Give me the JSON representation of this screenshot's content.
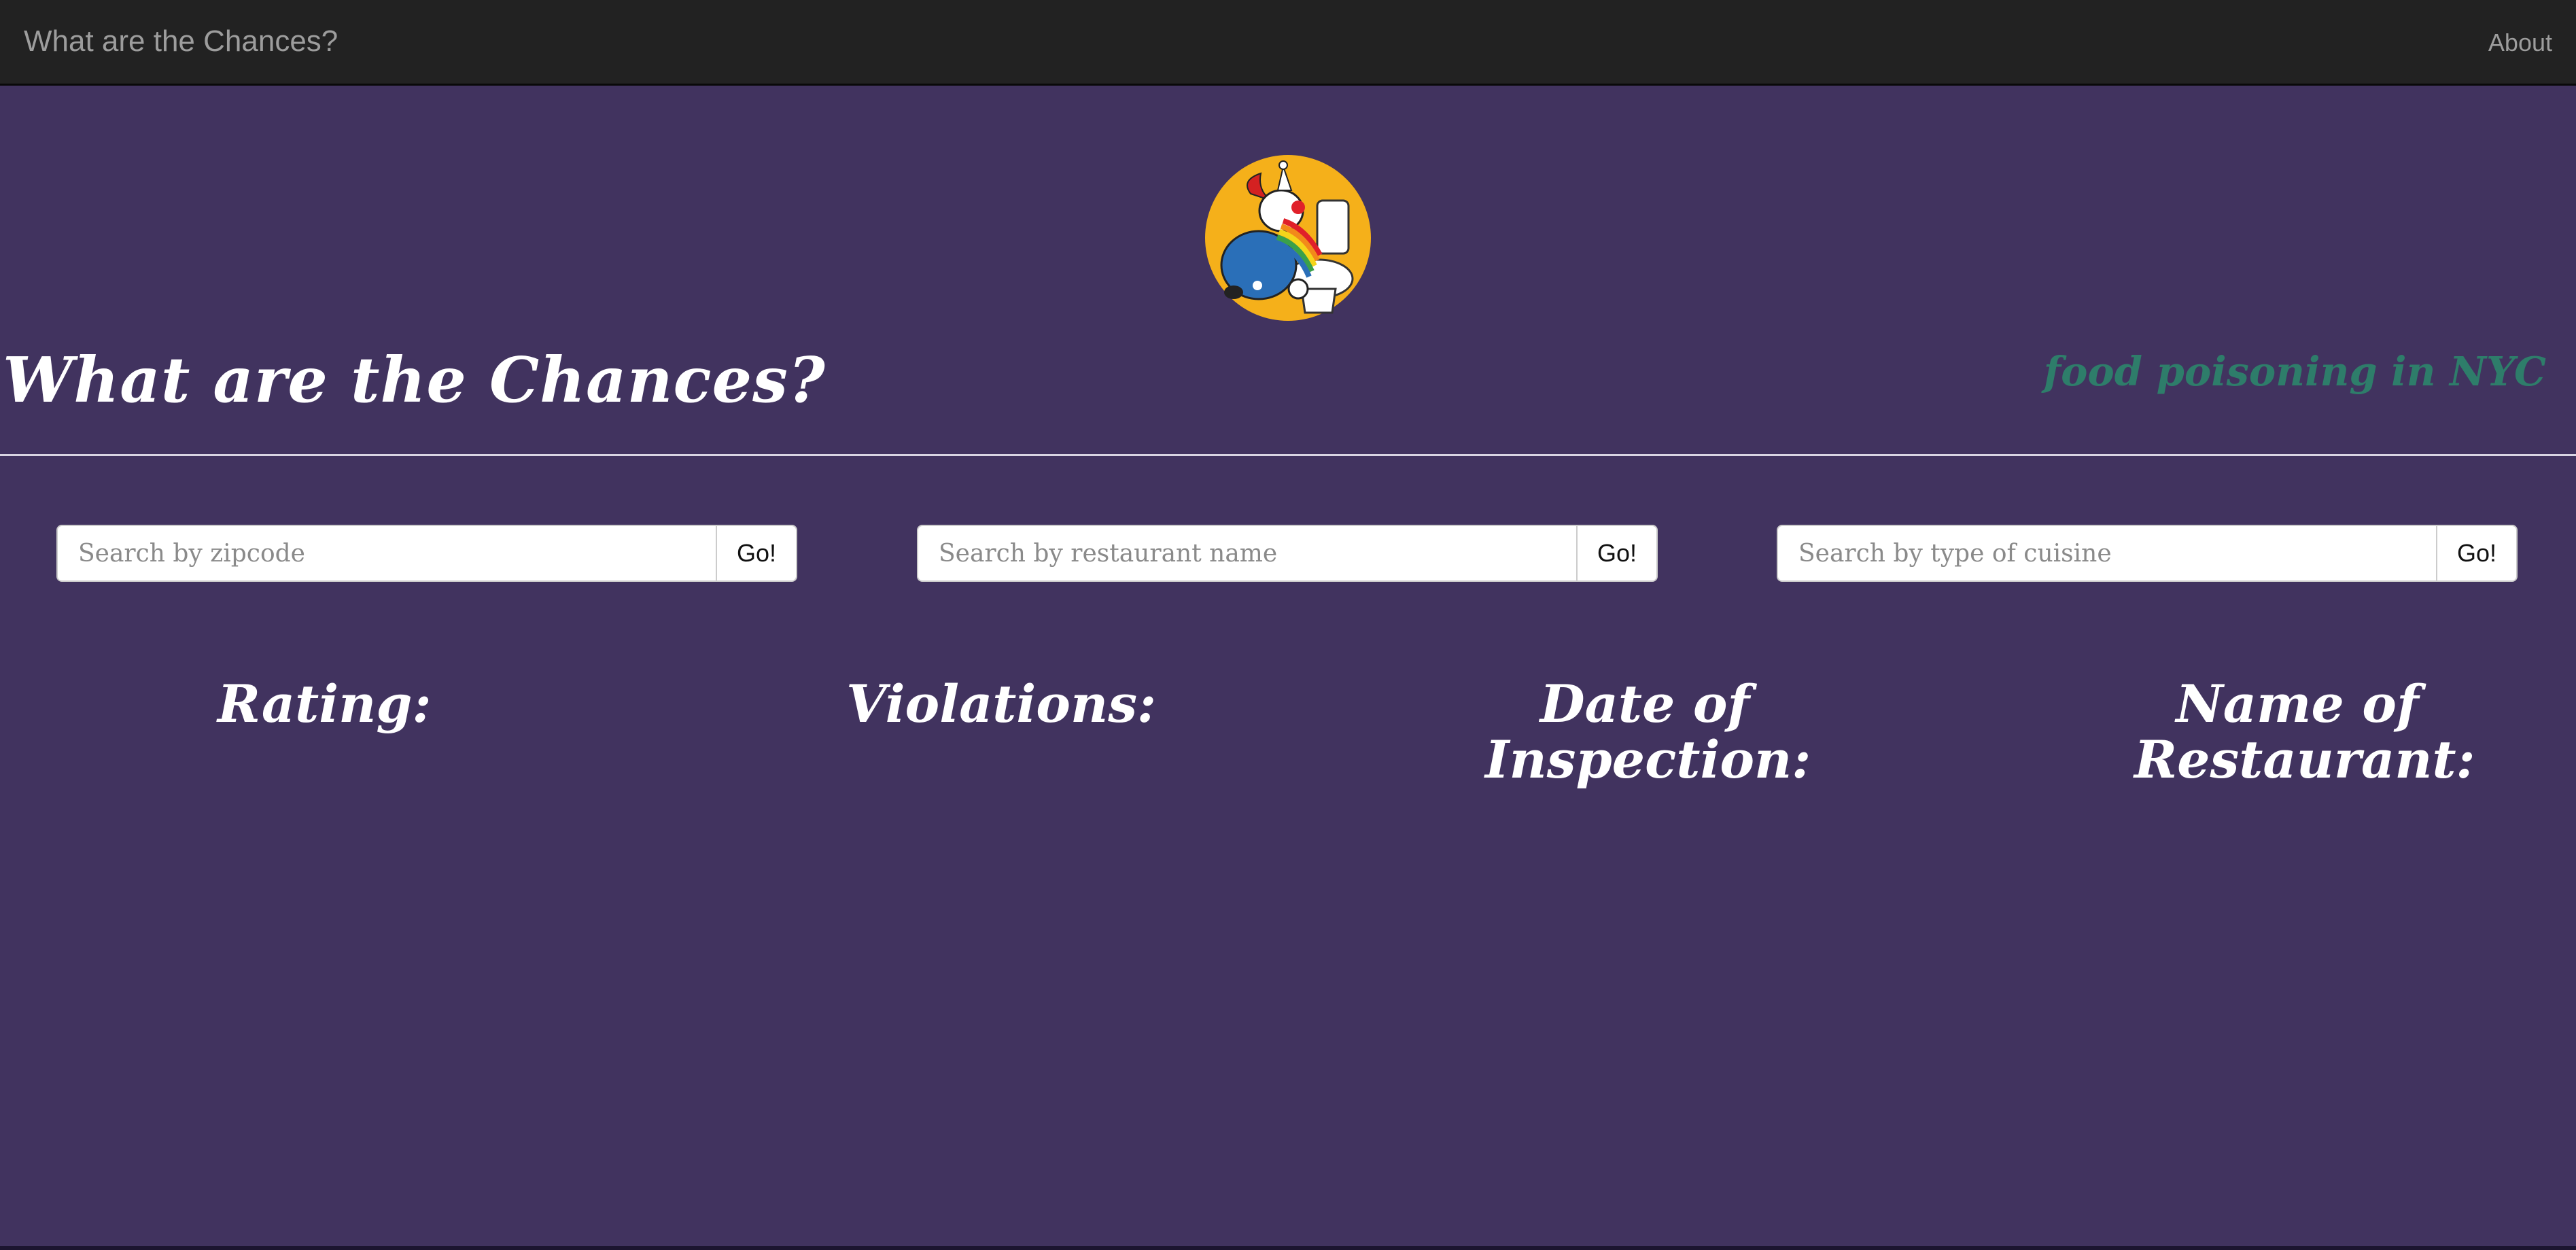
{
  "navbar": {
    "brand": "What are the Chances?",
    "about": "About"
  },
  "header": {
    "title": "What are the Chances?",
    "tagline": "food poisoning in NYC"
  },
  "search": [
    {
      "placeholder": "Search by zipcode",
      "button": "Go!"
    },
    {
      "placeholder": "Search by restaurant name",
      "button": "Go!"
    },
    {
      "placeholder": "Search by type of cuisine",
      "button": "Go!"
    }
  ],
  "columns": {
    "rating": "Rating:",
    "violations": "Violations:",
    "date_line1": "Date of",
    "date_line2": "Inspection:",
    "name_line1": "Name of",
    "name_line2": "Restaurant:"
  },
  "colors": {
    "background": "#41335f",
    "navbar": "#222222",
    "tagline": "#2e7d6a",
    "logo_circle": "#f5b01a"
  }
}
